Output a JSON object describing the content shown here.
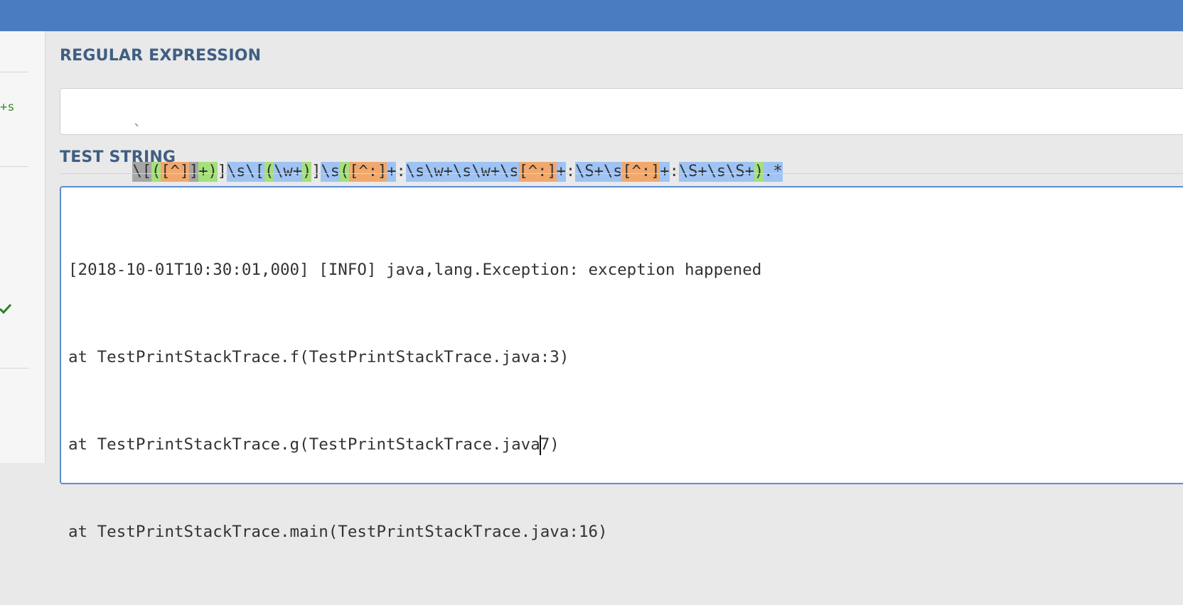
{
  "sidebar": {
    "snippet": "+s"
  },
  "regex": {
    "section_label": "REGULAR EXPRESSION",
    "delimiter": "`",
    "tokens": [
      {
        "text": "\\[",
        "c": "#a6a6a6"
      },
      {
        "text": "(",
        "c": "#a5e07a"
      },
      {
        "text": "[^]",
        "c": "#f2a86c"
      },
      {
        "text": "]",
        "c": "#a6a6a6"
      },
      {
        "text": "+",
        "c": "#a5e07a"
      },
      {
        "text": ")",
        "c": "#a5e07a"
      },
      {
        "text": "]",
        "c": ""
      },
      {
        "text": "\\s\\[",
        "c": "#9ec3f4"
      },
      {
        "text": "(",
        "c": "#a5e07a"
      },
      {
        "text": "\\w+",
        "c": "#9ec3f4"
      },
      {
        "text": ")",
        "c": "#a5e07a"
      },
      {
        "text": "]",
        "c": ""
      },
      {
        "text": "\\s",
        "c": "#9ec3f4"
      },
      {
        "text": "(",
        "c": "#a5e07a"
      },
      {
        "text": "[^:]",
        "c": "#f2a86c"
      },
      {
        "text": "+",
        "c": "#9ec3f4"
      },
      {
        "text": ":",
        "c": ""
      },
      {
        "text": "\\s\\w+\\s\\w+\\s",
        "c": "#9ec3f4"
      },
      {
        "text": "[^:]",
        "c": "#f2a86c"
      },
      {
        "text": "+",
        "c": "#9ec3f4"
      },
      {
        "text": ":",
        "c": ""
      },
      {
        "text": "\\S+\\s",
        "c": "#9ec3f4"
      },
      {
        "text": "[^:]",
        "c": "#f2a86c"
      },
      {
        "text": "+",
        "c": "#9ec3f4"
      },
      {
        "text": ":",
        "c": ""
      },
      {
        "text": "\\S+\\s\\S+",
        "c": "#9ec3f4"
      },
      {
        "text": ")",
        "c": "#a5e07a"
      },
      {
        "text": ".*",
        "c": "#9ec3f4"
      }
    ]
  },
  "test": {
    "section_label": "TEST STRING",
    "lines": [
      "[2018-10-01T10:30:01,000] [INFO] java,lang.Exception: exception happened",
      "at TestPrintStackTrace.f(TestPrintStackTrace.java:3)",
      "at TestPrintStackTrace.g(TestPrintStackTrace.java7)",
      "at TestPrintStackTrace.main(TestPrintStackTrace.java:16)"
    ]
  }
}
